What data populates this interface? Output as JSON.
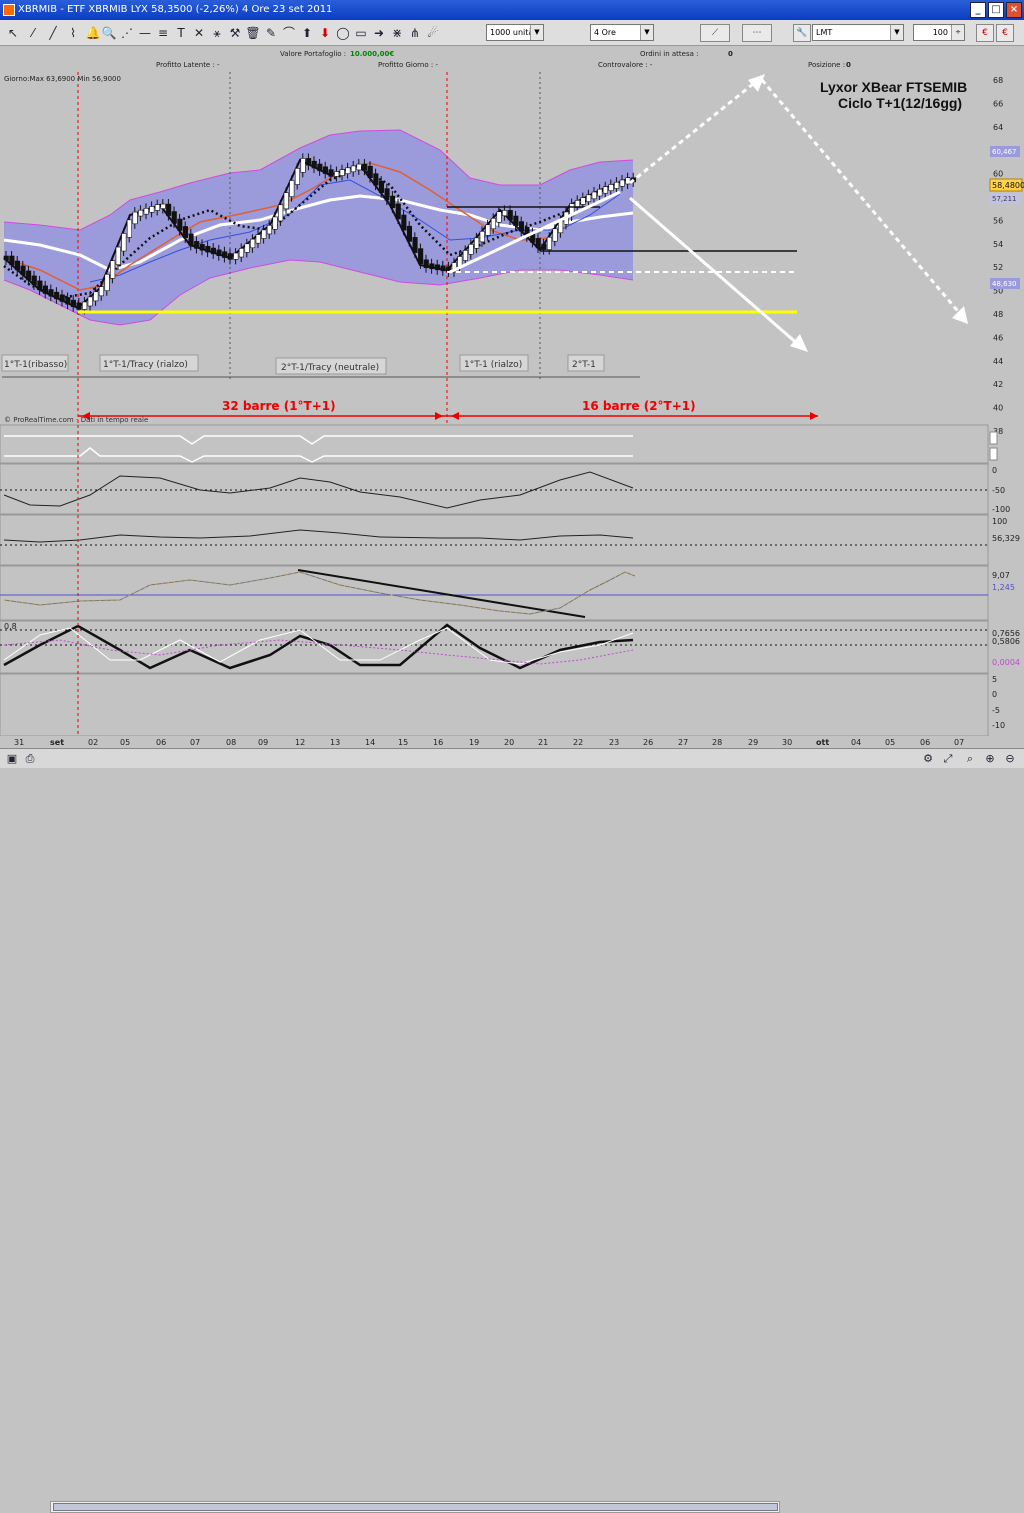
{
  "window": {
    "title": "XBRMIB - ETF XBRMIB LYX    58,3500 (-2,26%)    4 Ore  23 set 2011",
    "minimize": "_",
    "maximize": "□",
    "close": "×"
  },
  "toolbar": {
    "quantity": "1000 unità",
    "timeframe": "4 Ore",
    "order_type": "LMT",
    "price": "100"
  },
  "info": {
    "valore_portafoglio_label": "Valore Portafoglio :",
    "valore_portafoglio": "10.000,00€",
    "ordini_label": "Ordini in attesa :",
    "ordini": "0",
    "profitto_latente": "Profitto Latente : -",
    "profitto_giorno": "Profitto Giorno : -",
    "controvalore": "Controvalore : -",
    "posizione_label": "Posizione :",
    "posizione": "0"
  },
  "chart": {
    "daily_range": "Giorno:Max 63,6900 Min 56,9000",
    "annotation_title": "Lyxor XBear FTSEMIB",
    "annotation_subtitle": "Ciclo T+1(12/16gg)",
    "current_price": "58,4800",
    "price_label_upper": "60,467",
    "price_label_mid": "57,211",
    "price_label_lower": "48,630",
    "copyright": "© ProRealTime.com - Dati in tempo reale",
    "cycles": [
      {
        "label": "1°T-1(ribasso)"
      },
      {
        "label": "1°T-1/Tracy (rialzo)"
      },
      {
        "label": "2°T-1/Tracy (neutrale)"
      },
      {
        "label": "1°T-1 (rialzo)"
      },
      {
        "label": "2°T-1"
      }
    ],
    "bar_counts": [
      {
        "label": "32 barre (1°T+1)"
      },
      {
        "label": "16 barre (2°T+1)"
      }
    ],
    "y_ticks": [
      "68",
      "66",
      "64",
      "62",
      "60",
      "58",
      "56",
      "54",
      "52",
      "50",
      "48",
      "46",
      "44",
      "42",
      "40",
      "38"
    ],
    "x_ticks": [
      "31",
      "set",
      "02",
      "05",
      "06",
      "07",
      "08",
      "09",
      "12",
      "13",
      "14",
      "15",
      "16",
      "19",
      "20",
      "21",
      "22",
      "23",
      "26",
      "27",
      "28",
      "29",
      "30",
      "ott",
      "04",
      "05",
      "06",
      "07"
    ],
    "osc1_ticks": [
      "0",
      "-50",
      "-100"
    ],
    "osc2_ticks": [
      "100"
    ],
    "osc2_value": "56,329",
    "osc3_values": [
      "9,07",
      "1,245"
    ],
    "osc4_top": "0,8",
    "osc4_values": [
      "0,7656",
      "0,5806",
      "0,0004"
    ],
    "osc4_ticks": [
      "5",
      "0",
      "-5",
      "-10"
    ]
  },
  "colors": {
    "up_candle": "#ffffff",
    "down_candle": "#111111",
    "band_fill": "#9b9bdc",
    "band_line": "#d04ae0",
    "support": "#ffff00",
    "cycle_line": "#ee0000",
    "ma_red": "#e06030",
    "ma_blue": "#3050e0"
  }
}
